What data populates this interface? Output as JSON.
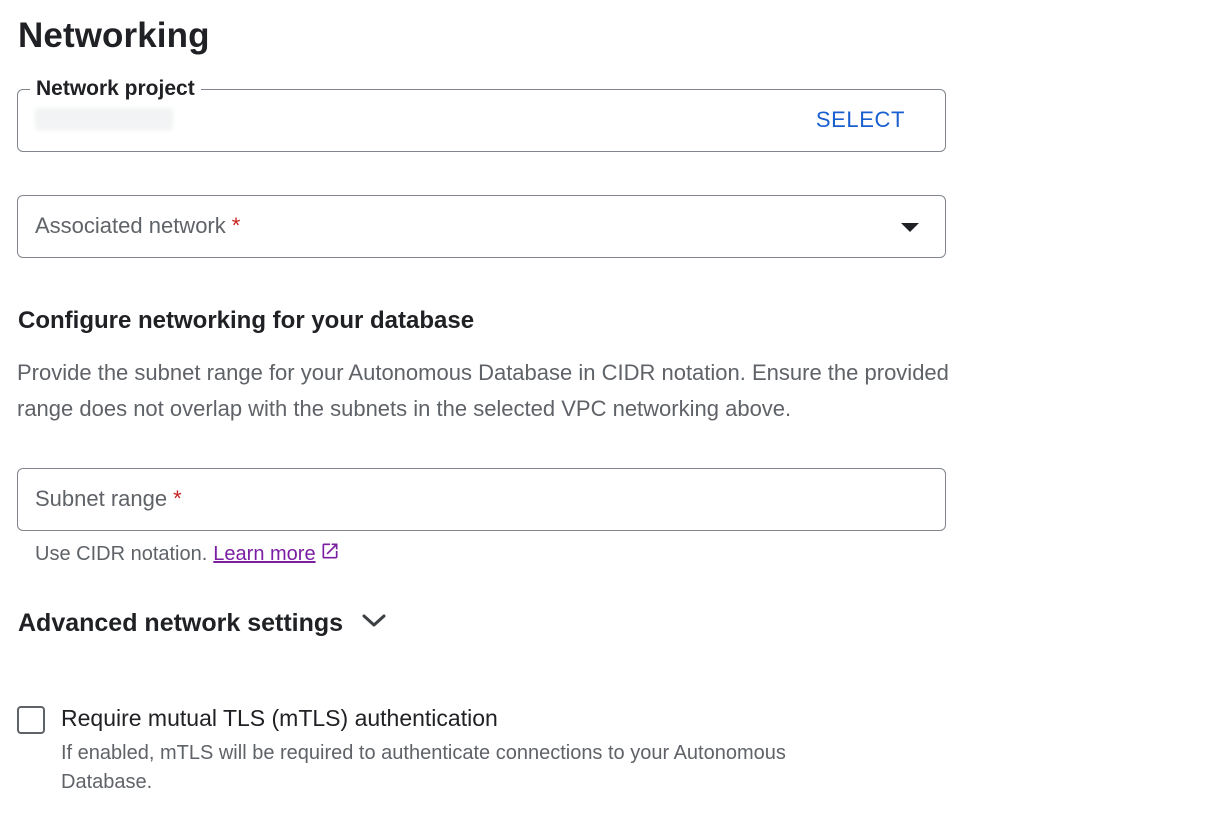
{
  "page_title": "Networking",
  "network_project": {
    "label": "Network project",
    "action_label": "SELECT"
  },
  "associated_network": {
    "placeholder": "Associated network",
    "required_marker": "*"
  },
  "configure_section": {
    "heading": "Configure networking for your database",
    "description": "Provide the subnet range for your Autonomous Database in CIDR notation. Ensure the provided range does not overlap with the subnets in the selected VPC networking above."
  },
  "subnet_range": {
    "placeholder": "Subnet range",
    "required_marker": "*",
    "helper_text": "Use CIDR notation.",
    "helper_link": "Learn more"
  },
  "advanced": {
    "label": "Advanced network settings"
  },
  "mtls": {
    "label": "Require mutual TLS (mTLS) authentication",
    "description": "If enabled, mTLS will be required to authenticate connections to your Autonomous Database."
  },
  "colors": {
    "link_blue": "#1a5fd0",
    "visited_link": "#7b1fa2",
    "required_red": "#c5221f",
    "border": "#80868b"
  },
  "icons": {
    "dropdown": "arrow-drop-down-icon",
    "external_link": "open-in-new-icon",
    "expand": "chevron-down-icon"
  }
}
